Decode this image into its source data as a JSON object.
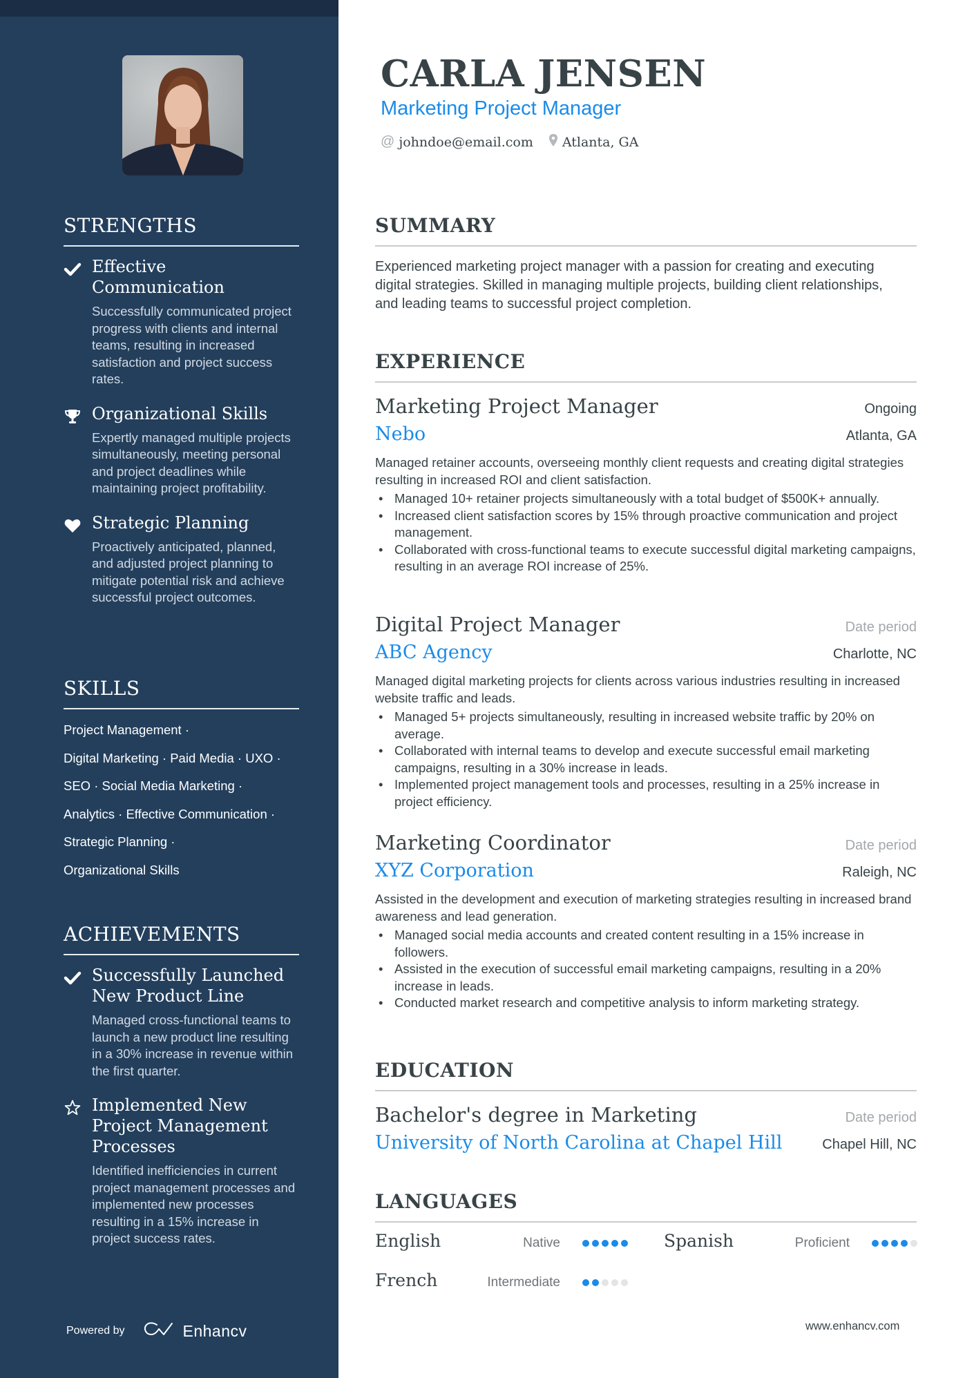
{
  "colors": {
    "sidebar_bg": "#233f5c",
    "sidebar_top": "#1b2d45",
    "accent": "#1a8be8",
    "text": "#384347",
    "muted": "#a3a8ac"
  },
  "header": {
    "name": "CARLA JENSEN",
    "title": "Marketing Project Manager",
    "email": "johndoe@email.com",
    "location": "Atlanta, GA",
    "email_icon": "at-icon",
    "location_icon": "map-pin-icon"
  },
  "sidebar": {
    "photo_alt": "profile-photo",
    "strengths": {
      "heading": "STRENGTHS",
      "items": [
        {
          "icon": "checkmark-icon",
          "title": "Effective Communication",
          "title_lines": [
            "Effective",
            "Communication"
          ],
          "desc": "Successfully communicated project progress with clients and internal teams, resulting in increased satisfaction and project success rates."
        },
        {
          "icon": "trophy-icon",
          "title": "Organizational Skills",
          "desc": "Expertly managed multiple projects simultaneously, meeting personal and project deadlines while maintaining project profitability."
        },
        {
          "icon": "heart-icon",
          "title": "Strategic Planning",
          "desc": "Proactively anticipated, planned, and adjusted project planning to mitigate potential risk and achieve successful project outcomes."
        }
      ]
    },
    "skills": {
      "heading": "SKILLS",
      "items": [
        "Project Management",
        "Digital Marketing",
        "Paid Media",
        "UXO",
        "SEO",
        "Social Media Marketing",
        "Analytics",
        "Effective Communication",
        "Strategic Planning",
        "Organizational Skills"
      ],
      "lines": [
        "Project Management ·",
        "Digital Marketing · Paid Media · UXO ·",
        "SEO · Social Media Marketing ·",
        "Analytics · Effective Communication ·",
        "Strategic Planning ·",
        "Organizational Skills"
      ]
    },
    "achievements": {
      "heading": "ACHIEVEMENTS",
      "items": [
        {
          "icon": "checkmark-icon",
          "title": "Successfully Launched New Product Line",
          "desc": "Managed cross-functional teams to launch a new product line resulting in a 30% increase in revenue within the first quarter."
        },
        {
          "icon": "star-outline-icon",
          "title": "Implemented New Project Management Processes",
          "desc": "Identified inefficiencies in current project management processes and implemented new processes resulting in a 15% increase in project success rates."
        }
      ]
    },
    "powered_by": {
      "label": "Powered by",
      "brand": "Enhancv",
      "brand_icon": "enhancv-logo-icon"
    }
  },
  "summary": {
    "heading": "SUMMARY",
    "text": "Experienced marketing project manager with a passion for creating and executing digital strategies. Skilled in managing multiple projects, building client relationships, and leading teams to successful project completion."
  },
  "experience": {
    "heading": "EXPERIENCE",
    "jobs": [
      {
        "title": "Marketing Project Manager",
        "company": "Nebo",
        "date": "Ongoing",
        "location": "Atlanta, GA",
        "description": "Managed retainer accounts, overseeing monthly client requests and creating digital strategies resulting in increased ROI and client satisfaction.",
        "bullets": [
          "Managed 10+ retainer projects simultaneously with a total budget of $500K+ annually.",
          "Increased client satisfaction scores by 15% through proactive communication and project management.",
          "Collaborated with cross-functional teams to execute successful digital marketing campaigns, resulting in an average ROI increase of 25%."
        ]
      },
      {
        "title": "Digital Project Manager",
        "company": "ABC Agency",
        "date": "Date period",
        "location": "Charlotte, NC",
        "description": "Managed digital marketing projects for clients across various industries resulting in increased website traffic and leads.",
        "bullets": [
          "Managed 5+ projects simultaneously, resulting in increased website traffic by 20% on average.",
          "Collaborated with internal teams to develop and execute successful email marketing campaigns, resulting in a 30% increase in leads.",
          "Implemented project management tools and processes, resulting in a 25% increase in project efficiency."
        ]
      },
      {
        "title": "Marketing Coordinator",
        "company": "XYZ Corporation",
        "date": "Date period",
        "location": "Raleigh, NC",
        "description": "Assisted in the development and execution of marketing strategies resulting in increased brand awareness and lead generation.",
        "bullets": [
          "Managed social media accounts and created content resulting in a 15% increase in followers.",
          "Assisted in the execution of successful email marketing campaigns, resulting in a 20% increase in leads.",
          "Conducted market research and competitive analysis to inform marketing strategy."
        ]
      }
    ]
  },
  "education": {
    "heading": "EDUCATION",
    "items": [
      {
        "degree": "Bachelor's degree in Marketing",
        "school": "University of North Carolina at Chapel Hill",
        "date": "Date period",
        "location": "Chapel Hill, NC"
      }
    ]
  },
  "languages": {
    "heading": "LANGUAGES",
    "items": [
      {
        "name": "English",
        "level": "Native",
        "rating": 5,
        "max": 5
      },
      {
        "name": "Spanish",
        "level": "Proficient",
        "rating": 4,
        "max": 5
      },
      {
        "name": "French",
        "level": "Intermediate",
        "rating": 2,
        "max": 5
      }
    ]
  },
  "footer": {
    "url": "www.enhancv.com"
  }
}
